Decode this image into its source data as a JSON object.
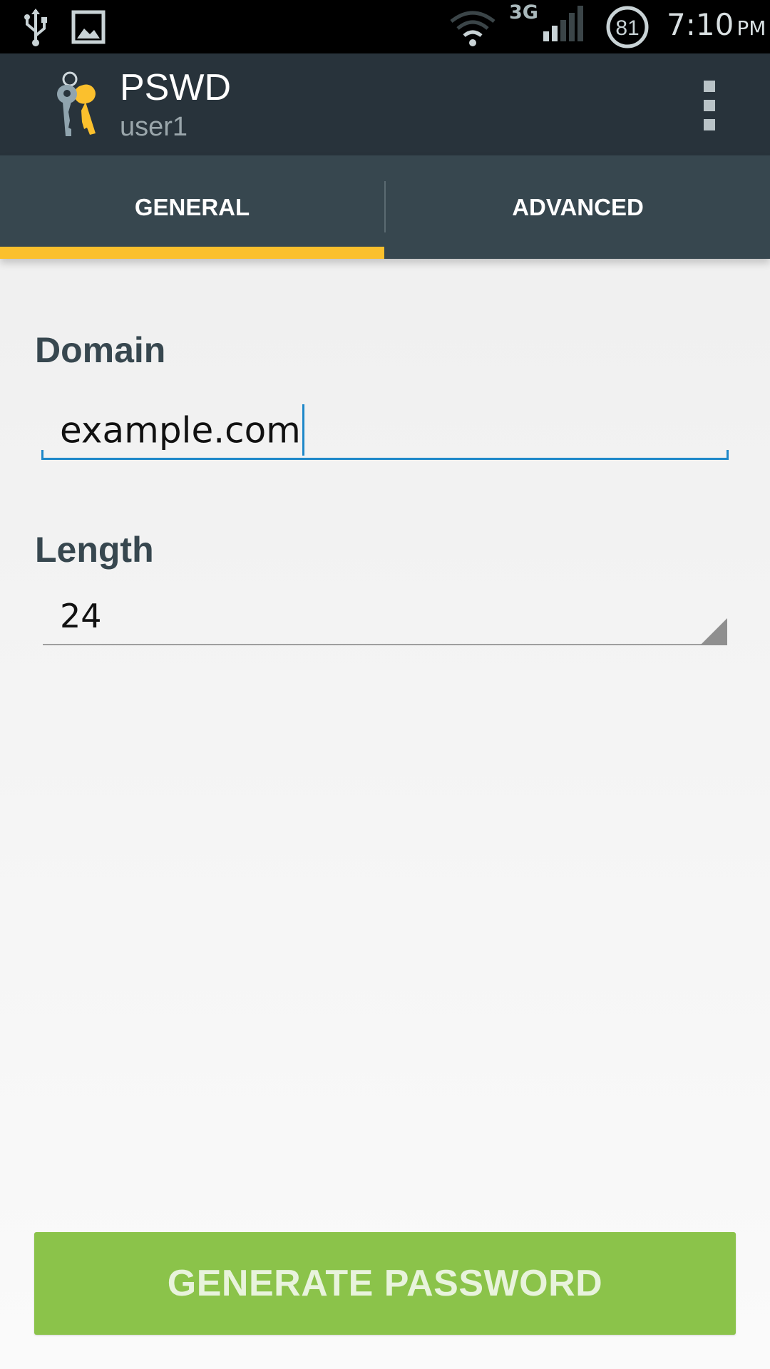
{
  "status_bar": {
    "network_type": "3G",
    "battery_level": "81",
    "time": "7:10",
    "time_suffix": "PM",
    "icons": [
      "usb-icon",
      "image-icon",
      "wifi-icon",
      "signal-icon",
      "battery-icon"
    ]
  },
  "app_bar": {
    "title": "PSWD",
    "subtitle": "user1",
    "logo_icon": "keys-icon",
    "menu_icon": "overflow-menu-icon"
  },
  "tabs": [
    {
      "label": "GENERAL",
      "selected": true
    },
    {
      "label": "ADVANCED",
      "selected": false
    }
  ],
  "form": {
    "domain": {
      "label": "Domain",
      "value": "example.com"
    },
    "length": {
      "label": "Length",
      "value": "24"
    }
  },
  "actions": {
    "generate_label": "GENERATE PASSWORD"
  },
  "colors": {
    "app_bar": "#28333b",
    "tab_bar": "#37474f",
    "tab_indicator": "#fbc02d",
    "focus": "#1e88c9",
    "button": "#8bc34a",
    "label_text": "#37474f"
  }
}
